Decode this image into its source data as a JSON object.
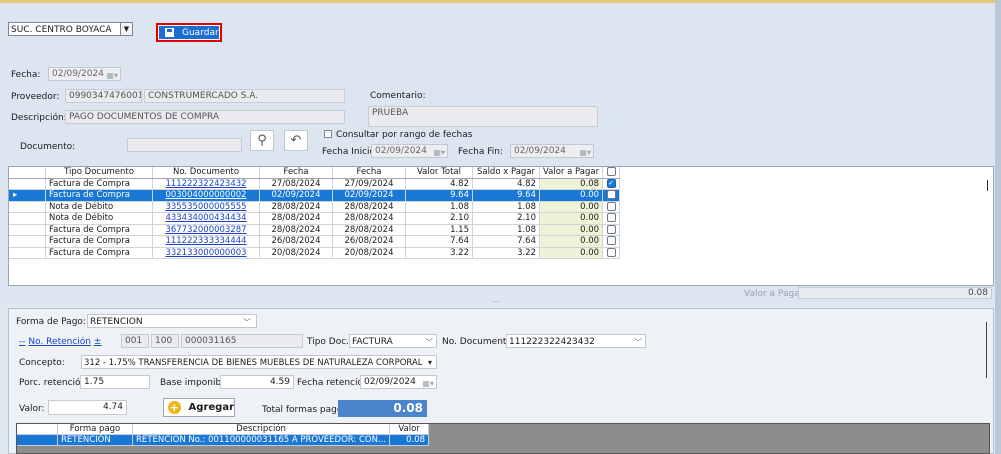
{
  "sucursal": "SUC. CENTRO BOYACA",
  "toolbar": {
    "save_label": "Guardar"
  },
  "fecha": {
    "label": "Fecha:",
    "value": "02/09/2024"
  },
  "proveedor": {
    "label": "Proveedor:",
    "id": "0990347476001",
    "name": "CONSTRUMERCADO S.A."
  },
  "descripcion": {
    "label": "Descripción:",
    "value": "PAGO DOCUMENTOS DE COMPRA"
  },
  "comentario": {
    "label": "Comentario:",
    "value": "PRUEBA"
  },
  "documento": {
    "label": "Documento:",
    "value": ""
  },
  "rango": {
    "label": "Consultar por rango de fechas",
    "inicio_label": "Fecha Inicio:",
    "inicio": "02/09/2024",
    "fin_label": "Fecha Fin:",
    "fin": "02/09/2024"
  },
  "grid": {
    "headers": [
      "Tipo Documento",
      "No. Documento",
      "Fecha",
      "Fecha",
      "Valor Total",
      "Saldo x Pagar",
      "Valor a Pagar"
    ],
    "rows": [
      {
        "tipo": "Factura de Compra",
        "doc": "111222322423432",
        "f1": "27/08/2024",
        "f2": "27/09/2024",
        "total": "4.82",
        "saldo": "4.82",
        "pagar": "0.08"
      },
      {
        "tipo": "Factura de Compra",
        "doc": "003004000000002",
        "f1": "02/09/2024",
        "f2": "02/09/2024",
        "total": "9.64",
        "saldo": "9.64",
        "pagar": "0.00"
      },
      {
        "tipo": "Nota de Débito",
        "doc": "335535000005555",
        "f1": "28/08/2024",
        "f2": "28/08/2024",
        "total": "1.08",
        "saldo": "1.08",
        "pagar": "0.00"
      },
      {
        "tipo": "Nota de Débito",
        "doc": "433434000434434",
        "f1": "28/08/2024",
        "f2": "28/08/2024",
        "total": "2.10",
        "saldo": "2.10",
        "pagar": "0.00"
      },
      {
        "tipo": "Factura de Compra",
        "doc": "367732000003287",
        "f1": "28/08/2024",
        "f2": "28/08/2024",
        "total": "1.15",
        "saldo": "1.08",
        "pagar": "0.00"
      },
      {
        "tipo": "Factura de Compra",
        "doc": "111222333334444",
        "f1": "26/08/2024",
        "f2": "26/08/2024",
        "total": "7.64",
        "saldo": "7.64",
        "pagar": "0.00"
      },
      {
        "tipo": "Factura de Compra",
        "doc": "332133000000003",
        "f1": "20/08/2024",
        "f2": "20/08/2024",
        "total": "3.22",
        "saldo": "3.22",
        "pagar": "0.00"
      }
    ],
    "dots": "...."
  },
  "valor_a_pagar": {
    "label": "Valor a Pagar:",
    "value": "0.08"
  },
  "forma_pago": {
    "label": "Forma de Pago:",
    "value": "RETENCION"
  },
  "retencion": {
    "label": "No. Retención",
    "plus": "±",
    "p1": "001",
    "p2": "100",
    "p3": "000031165",
    "tipo_doc_label": "Tipo Doc.:",
    "tipo_doc": "FACTURA",
    "no_doc_label": "No. Documento:",
    "no_doc": "111222322423432"
  },
  "concepto": {
    "label": "Concepto:",
    "value": "312 - 1.75% TRANSFERENCIA DE BIENES MUEBLES DE NATURALEZA CORPORAL"
  },
  "porc": {
    "label": "Porc. retención:",
    "value": "1.75"
  },
  "base": {
    "label": "Base imponible:",
    "value": "4.59"
  },
  "fecha_ret": {
    "label": "Fecha retención:",
    "value": "02/09/2024"
  },
  "valor": {
    "label": "Valor:",
    "value": "4.74"
  },
  "agregar_label": "Agregar",
  "total": {
    "label": "Total formas pago:",
    "value": "0.08"
  },
  "pagos": {
    "headers": [
      "Forma pago",
      "Descripción",
      "Valor"
    ],
    "rows": [
      {
        "forma": "RETENCION",
        "desc": "RETENCION No.: 001100000031165 A PROVEEDOR: CON...",
        "valor": "0.08"
      }
    ]
  }
}
